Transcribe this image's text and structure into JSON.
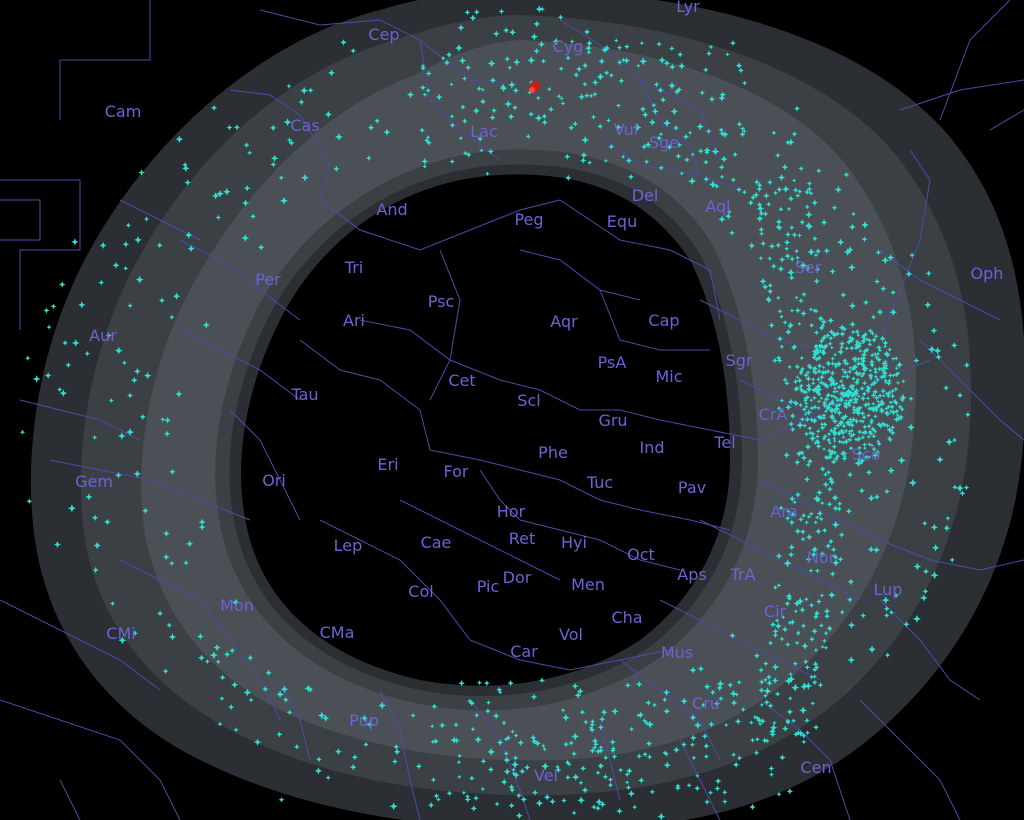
{
  "view": {
    "description_colors": {
      "background": "#000000",
      "milky_way_outer": "#2b2f33",
      "milky_way_mid": "#3b4045",
      "milky_way_inner": "#4a5055",
      "constellation_lines": "#4e4aa8",
      "constellation_labels": "#6b63d6",
      "star_markers": "#2fe0d2",
      "highlight_marker": "#d11a1a"
    },
    "icons": {
      "star_marker": "four-point-star-icon",
      "highlight_marker": "red-dot-icon"
    }
  },
  "constellations": [
    {
      "id": "lyr",
      "label": "Lyr"
    },
    {
      "id": "cep",
      "label": "Cep"
    },
    {
      "id": "cyg",
      "label": "Cyg"
    },
    {
      "id": "cam",
      "label": "Cam"
    },
    {
      "id": "cas",
      "label": "Cas"
    },
    {
      "id": "lac",
      "label": "Lac"
    },
    {
      "id": "vul",
      "label": "Vul"
    },
    {
      "id": "sge",
      "label": "Sge"
    },
    {
      "id": "and",
      "label": "And"
    },
    {
      "id": "peg",
      "label": "Peg"
    },
    {
      "id": "equ",
      "label": "Equ"
    },
    {
      "id": "del",
      "label": "Del"
    },
    {
      "id": "aql",
      "label": "Aql"
    },
    {
      "id": "tri",
      "label": "Tri"
    },
    {
      "id": "per",
      "label": "Per"
    },
    {
      "id": "ser",
      "label": "Ser"
    },
    {
      "id": "oph",
      "label": "Oph"
    },
    {
      "id": "ari",
      "label": "Ari"
    },
    {
      "id": "psc",
      "label": "Psc"
    },
    {
      "id": "aqr",
      "label": "Aqr"
    },
    {
      "id": "cap",
      "label": "Cap"
    },
    {
      "id": "aur",
      "label": "Aur"
    },
    {
      "id": "psa",
      "label": "PsA"
    },
    {
      "id": "sgr",
      "label": "Sgr"
    },
    {
      "id": "cet",
      "label": "Cet"
    },
    {
      "id": "mic",
      "label": "Mic"
    },
    {
      "id": "tau",
      "label": "Tau"
    },
    {
      "id": "scl",
      "label": "Scl"
    },
    {
      "id": "gru",
      "label": "Gru"
    },
    {
      "id": "cra",
      "label": "CrA"
    },
    {
      "id": "tel",
      "label": "Tel"
    },
    {
      "id": "eri",
      "label": "Eri"
    },
    {
      "id": "ind",
      "label": "Ind"
    },
    {
      "id": "phe",
      "label": "Phe"
    },
    {
      "id": "sco",
      "label": "Sco"
    },
    {
      "id": "for",
      "label": "For"
    },
    {
      "id": "gem",
      "label": "Gem"
    },
    {
      "id": "ori",
      "label": "Ori"
    },
    {
      "id": "tuc",
      "label": "Tuc"
    },
    {
      "id": "pav",
      "label": "Pav"
    },
    {
      "id": "hor",
      "label": "Hor"
    },
    {
      "id": "ara",
      "label": "Ara"
    },
    {
      "id": "lep",
      "label": "Lep"
    },
    {
      "id": "cae",
      "label": "Cae"
    },
    {
      "id": "ret",
      "label": "Ret"
    },
    {
      "id": "hyi",
      "label": "Hyi"
    },
    {
      "id": "oct",
      "label": "Oct"
    },
    {
      "id": "nor",
      "label": "Nor"
    },
    {
      "id": "aps",
      "label": "Aps"
    },
    {
      "id": "tra",
      "label": "TrA"
    },
    {
      "id": "dor",
      "label": "Dor"
    },
    {
      "id": "lup",
      "label": "Lup"
    },
    {
      "id": "men",
      "label": "Men"
    },
    {
      "id": "col",
      "label": "Col"
    },
    {
      "id": "pic",
      "label": "Pic"
    },
    {
      "id": "mon",
      "label": "Mon"
    },
    {
      "id": "cha",
      "label": "Cha"
    },
    {
      "id": "cir",
      "label": "Cir"
    },
    {
      "id": "cmi",
      "label": "CMi"
    },
    {
      "id": "cma",
      "label": "CMa"
    },
    {
      "id": "vol",
      "label": "Vol"
    },
    {
      "id": "car",
      "label": "Car"
    },
    {
      "id": "mus",
      "label": "Mus"
    },
    {
      "id": "cru",
      "label": "Cru"
    },
    {
      "id": "pup",
      "label": "Pup"
    },
    {
      "id": "vel",
      "label": "Vel"
    },
    {
      "id": "cen",
      "label": "Cen"
    }
  ]
}
